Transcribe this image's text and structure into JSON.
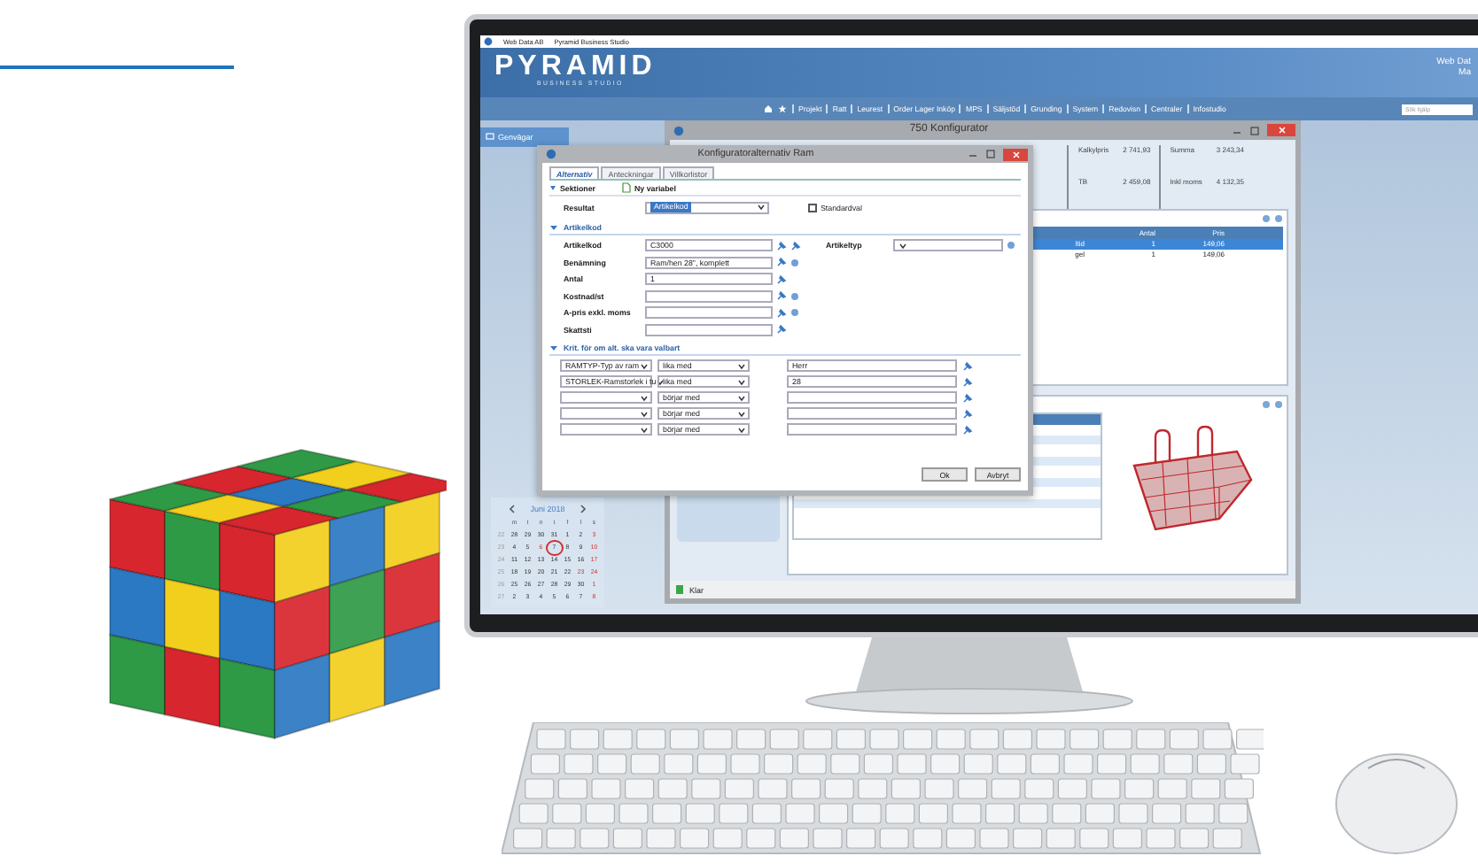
{
  "title_bar": {
    "company": "Web Data AB",
    "product": "Pyramid Business Studio"
  },
  "header": {
    "logo": "PYRAMID",
    "logo_subtitle": "BUSINESS STUDIO",
    "user_lines": [
      "Web Dat",
      "Ma"
    ]
  },
  "nav": {
    "items": [
      "Projekt",
      "Ratt",
      "Leurest",
      "Order Lager Inköp",
      "MPS",
      "Säljstöd",
      "Grunding",
      "System",
      "Redovisn",
      "Centraler",
      "Infostudio"
    ],
    "search_placeholder": "Sök hjälp"
  },
  "shortcuts_tab": "Genvägar",
  "calendar": {
    "month": "Juni 2018",
    "weekdays": [
      "m",
      "t",
      "o",
      "t",
      "f",
      "l",
      "s"
    ],
    "weeks": [
      {
        "week": "22",
        "days": [
          {
            "day": "28",
            "holiday": false,
            "selected": false
          },
          {
            "day": "29",
            "holiday": false,
            "selected": false
          },
          {
            "day": "30",
            "holiday": false,
            "selected": false
          },
          {
            "day": "31",
            "holiday": false,
            "selected": false
          },
          {
            "day": "1",
            "holiday": false,
            "selected": false
          },
          {
            "day": "2",
            "holiday": false,
            "selected": false
          },
          {
            "day": "3",
            "holiday": true,
            "selected": false
          }
        ]
      },
      {
        "week": "23",
        "days": [
          {
            "day": "4",
            "holiday": false,
            "selected": false
          },
          {
            "day": "5",
            "holiday": false,
            "selected": false
          },
          {
            "day": "6",
            "holiday": true,
            "selected": false
          },
          {
            "day": "7",
            "holiday": false,
            "selected": true
          },
          {
            "day": "8",
            "holiday": false,
            "selected": false
          },
          {
            "day": "9",
            "holiday": false,
            "selected": false
          },
          {
            "day": "10",
            "holiday": true,
            "selected": false
          }
        ]
      },
      {
        "week": "24",
        "days": [
          {
            "day": "11",
            "holiday": false,
            "selected": false
          },
          {
            "day": "12",
            "holiday": false,
            "selected": false
          },
          {
            "day": "13",
            "holiday": false,
            "selected": false
          },
          {
            "day": "14",
            "holiday": false,
            "selected": false
          },
          {
            "day": "15",
            "holiday": false,
            "selected": false
          },
          {
            "day": "16",
            "holiday": false,
            "selected": false
          },
          {
            "day": "17",
            "holiday": true,
            "selected": false
          }
        ]
      },
      {
        "week": "25",
        "days": [
          {
            "day": "18",
            "holiday": false,
            "selected": false
          },
          {
            "day": "19",
            "holiday": false,
            "selected": false
          },
          {
            "day": "20",
            "holiday": false,
            "selected": false
          },
          {
            "day": "21",
            "holiday": false,
            "selected": false
          },
          {
            "day": "22",
            "holiday": false,
            "selected": false
          },
          {
            "day": "23",
            "holiday": true,
            "selected": false
          },
          {
            "day": "24",
            "holiday": true,
            "selected": false
          }
        ]
      },
      {
        "week": "26",
        "days": [
          {
            "day": "25",
            "holiday": false,
            "selected": false
          },
          {
            "day": "26",
            "holiday": false,
            "selected": false
          },
          {
            "day": "27",
            "holiday": false,
            "selected": false
          },
          {
            "day": "28",
            "holiday": false,
            "selected": false
          },
          {
            "day": "29",
            "holiday": false,
            "selected": false
          },
          {
            "day": "30",
            "holiday": false,
            "selected": false
          },
          {
            "day": "1",
            "holiday": true,
            "selected": false
          }
        ]
      },
      {
        "week": "27",
        "days": [
          {
            "day": "2",
            "holiday": false,
            "selected": false
          },
          {
            "day": "3",
            "holiday": false,
            "selected": false
          },
          {
            "day": "4",
            "holiday": false,
            "selected": false
          },
          {
            "day": "5",
            "holiday": false,
            "selected": false
          },
          {
            "day": "6",
            "holiday": false,
            "selected": false
          },
          {
            "day": "7",
            "holiday": false,
            "selected": false
          },
          {
            "day": "8",
            "holiday": true,
            "selected": false
          }
        ]
      }
    ]
  },
  "back_window": {
    "title": "750 Konfigurator",
    "summary": [
      {
        "label": "Kalkylpris",
        "value": "2 741,93"
      },
      {
        "label": "TB",
        "value": "2 459,08"
      },
      {
        "label": "Summa",
        "value": "3 243,34"
      },
      {
        "label": "Inkl moms",
        "value": "4 132,35"
      }
    ],
    "table": {
      "columns": [
        "",
        "Antal",
        "Pris"
      ],
      "rows": [
        {
          "cells": [
            "ltid",
            "1",
            "149,06"
          ],
          "selected": true
        },
        {
          "cells": [
            "gel",
            "1",
            "149,06"
          ],
          "selected": false
        }
      ]
    },
    "status": "Klar"
  },
  "dialog": {
    "title": "Konfiguratoralternativ Ram",
    "tabs": [
      {
        "label": "Alternativ",
        "selected": true
      },
      {
        "label": "Anteckningar",
        "selected": false
      },
      {
        "label": "Villkorlistor",
        "selected": false
      }
    ],
    "toolbar": [
      "Sektioner",
      "Ny variabel"
    ],
    "result": {
      "label": "Resultat",
      "value": "Artikelkod"
    },
    "default_choice": {
      "label": "Standardval",
      "checked": false
    },
    "article_section": {
      "title": "Artikelkod",
      "expanded": true,
      "fields": [
        {
          "label": "Artikelkod",
          "value": "C3000"
        },
        {
          "label": "Benämning",
          "value": "Ram/hen 28\", komplett"
        },
        {
          "label": "Antal",
          "value": "1"
        },
        {
          "label": "Kostnad/st"
        },
        {
          "label": "A-pris exkl. moms"
        },
        {
          "label": "Skattsti"
        }
      ],
      "article_type": {
        "label": "Artikeltyp"
      }
    },
    "criteria_section": {
      "title": "Krit. för om alt. ska vara valbart",
      "expanded": true,
      "rows": [
        {
          "variable": "RAMTYP-Typ av ram",
          "operator": "lika med",
          "value": "Herr"
        },
        {
          "variable": "STORLEK-Ramstorlek i tu",
          "operator": "lika med",
          "value": "28"
        },
        {
          "operator": "börjar med"
        },
        {
          "operator": "börjar med"
        },
        {
          "operator": "börjar med"
        }
      ]
    },
    "buttons": [
      "Ok",
      "Avbryt"
    ]
  }
}
